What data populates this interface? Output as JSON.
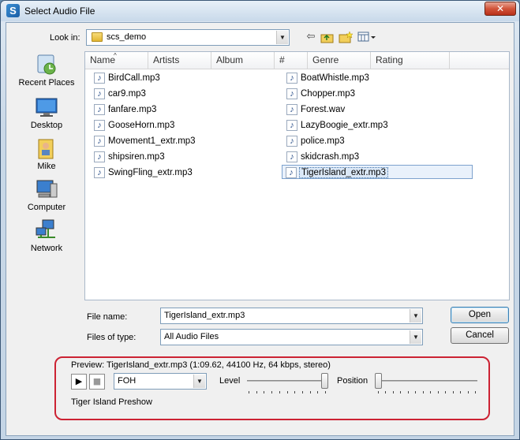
{
  "window": {
    "title": "Select Audio File",
    "close_glyph": "✕"
  },
  "toolbar": {
    "look_in_label": "Look in:",
    "look_in_value": "scs_demo",
    "icons": [
      "back-icon",
      "up-folder-icon",
      "new-folder-icon",
      "views-icon"
    ]
  },
  "places": [
    {
      "label": "Recent Places",
      "icon": "recent-places-icon"
    },
    {
      "label": "Desktop",
      "icon": "desktop-icon"
    },
    {
      "label": "Mike",
      "icon": "user-folder-icon"
    },
    {
      "label": "Computer",
      "icon": "computer-icon"
    },
    {
      "label": "Network",
      "icon": "network-icon"
    }
  ],
  "columns": [
    "Name",
    "Artists",
    "Album",
    "#",
    "Genre",
    "Rating"
  ],
  "files_col1": [
    "BirdCall.mp3",
    "car9.mp3",
    "fanfare.mp3",
    "GooseHorn.mp3",
    "Movement1_extr.mp3",
    "shipsiren.mp3",
    "SwingFling_extr.mp3"
  ],
  "files_col2": [
    "BoatWhistle.mp3",
    "Chopper.mp3",
    "Forest.wav",
    "LazyBoogie_extr.mp3",
    "police.mp3",
    "skidcrash.mp3",
    "TigerIsland_extr.mp3"
  ],
  "selected_file": "TigerIsland_extr.mp3",
  "form": {
    "file_name_label": "File name:",
    "file_name_value": "TigerIsland_extr.mp3",
    "file_type_label": "Files of type:",
    "file_type_value": "All Audio Files",
    "open_label": "Open",
    "cancel_label": "Cancel"
  },
  "preview": {
    "text": "Preview: TigerIsland_extr.mp3 (1:09.62, 44100 Hz, 64 kbps, stereo)",
    "device_value": "FOH",
    "level_label": "Level",
    "level_value": 1.0,
    "position_label": "Position",
    "position_value": 0.0,
    "description": "Tiger Island Preshow"
  },
  "colors": {
    "highlight_box": "#cc2233",
    "selection": "#dbe8f7"
  }
}
